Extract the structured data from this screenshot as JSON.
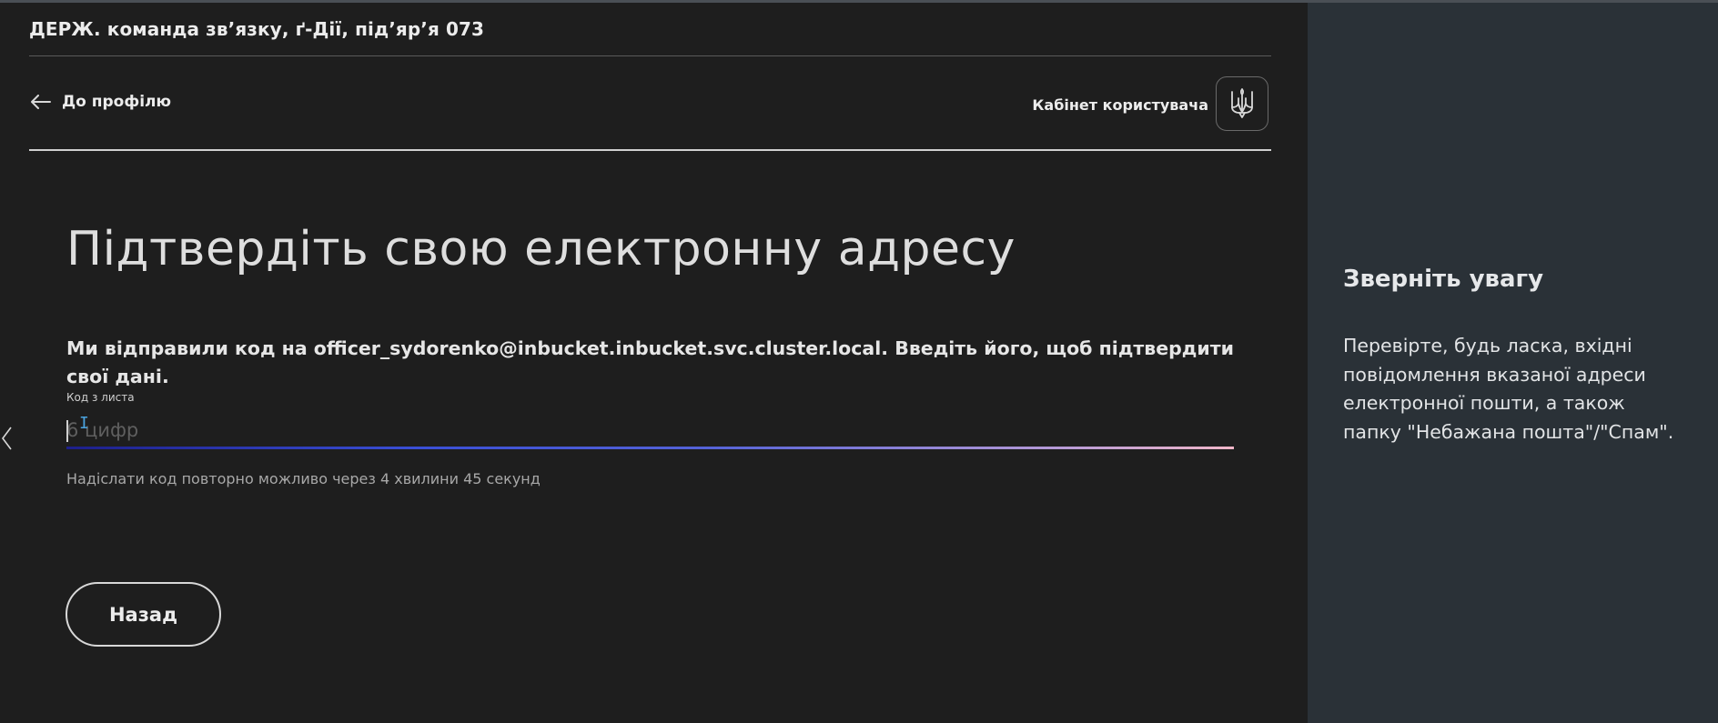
{
  "header": {
    "org_title": "ДЕРЖ. команда зв’язку, ґ-Дії, під’яр’я 073",
    "back_link_label": "До профілю",
    "cabinet_label": "Кабінет користувача"
  },
  "main": {
    "title": "Підтвердіть свою електронну адресу",
    "description": "Ми відправили код на officer_sydorenko@inbucket.inbucket.svc.cluster.local. Введіть його, щоб підтвердити свої дані.",
    "code_field": {
      "label": "Код з листа",
      "placeholder": "6 цифр",
      "value": ""
    },
    "resend_hint": "Надіслати код повторно можливо через 4 хвилини 45 секунд",
    "back_button_label": "Назад"
  },
  "aside": {
    "heading": "Зверніть увагу",
    "text": "Перевірте, будь ласка, вхідні повідомлення вказаної адреси електронної пошти, а також папку \"Небажана пошта\"/\"Спам\"."
  },
  "icons": {
    "back": "arrow-left-icon",
    "emblem": "trident-emblem-icon",
    "slider_prev": "chevron-left-icon"
  },
  "colors": {
    "background": "#1e1e1e",
    "aside_background": "#2a3137",
    "accent_gradient_start": "#1d1f8a",
    "accent_gradient_end": "#f0b6c8"
  }
}
